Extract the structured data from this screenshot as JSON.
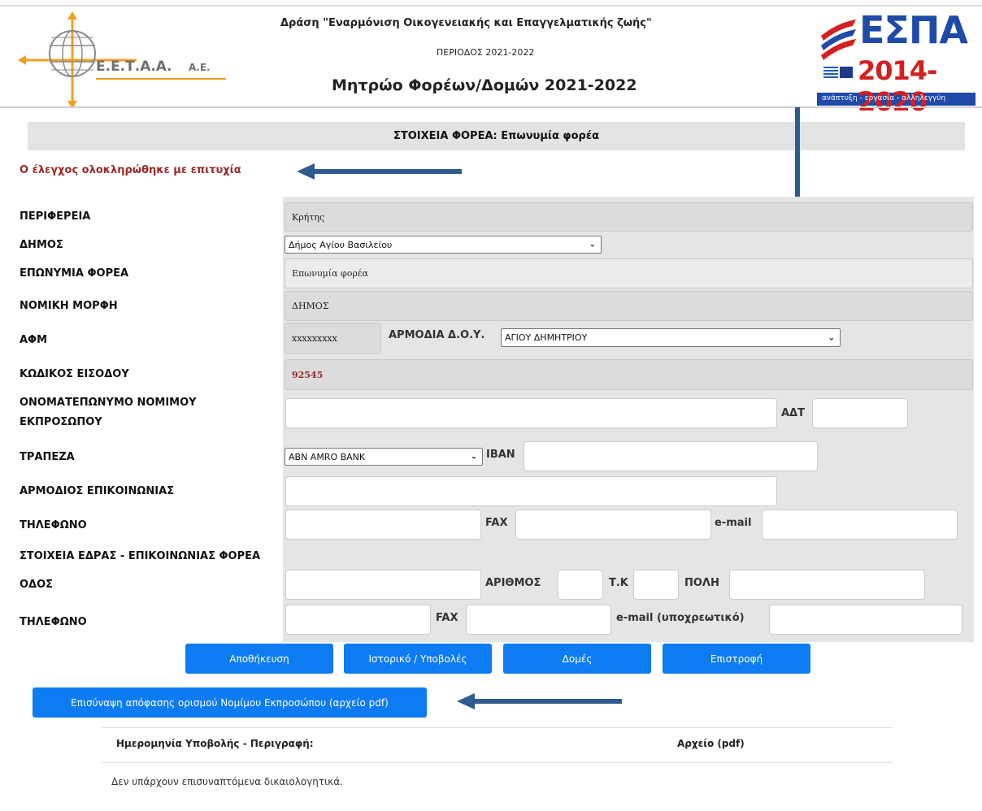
{
  "header": {
    "logo_text": "Ε.Ε.Τ.Α.Α.",
    "logo_suffix": "Α.Ε.",
    "action_title": "Δράση \"Εναρμόνιση Οικογενειακής και Επαγγελματικής ζωής\"",
    "period": "ΠΕΡΙΟΔΟΣ 2021-2022",
    "registry_title": "Μητρώο Φορέων/Δομών 2021-2022",
    "espa_logo": "ΕΣΠΑ",
    "espa_years": "2014-2020",
    "espa_slogan": "ανάπτυξη - εργασία - αλληλεγγύη"
  },
  "section_title": "ΣΤΟΙΧΕΙΑ ΦΟΡΕΑ: Επωνυμία φορέα",
  "success_message": "Ο έλεγχος ολοκληρώθηκε με επιτυχία",
  "labels": {
    "region": "ΠΕΡΙΦΕΡΕΙΑ",
    "municipality": "ΔΗΜΟΣ",
    "org_name": "ΕΠΩΝΥΜΙΑ ΦΟΡΕΑ",
    "legal_form": "ΝΟΜΙΚΗ ΜΟΡΦΗ",
    "afm": "ΑΦΜ",
    "tax_office": "ΑΡΜΟΔΙΑ Δ.Ο.Υ.",
    "login_code": "ΚΩΔΙΚΟΣ ΕΙΣΟΔΟΥ",
    "legal_rep_1": "ΟΝΟΜΑΤΕΠΩΝΥΜΟ ΝΟΜΙΜΟΥ",
    "legal_rep_2": "ΕΚΠΡΟΣΩΠΟΥ",
    "adt": "ΑΔΤ",
    "bank": "ΤΡΑΠΕΖΑ",
    "iban": "IBAN",
    "contact_person": "ΑΡΜΟΔΙΟΣ ΕΠΙΚΟΙΝΩΝΙΑΣ",
    "phone": "ΤΗΛΕΦΩΝΟ",
    "fax": "FAX",
    "email": "e-mail",
    "hq_header": "ΣΤΟΙΧΕΙΑ ΕΔΡΑΣ - ΕΠΙΚΟΙΝΩΝΙΑΣ ΦΟΡΕΑ",
    "street": "ΟΔΟΣ",
    "number": "ΑΡΙΘΜΟΣ",
    "postal_code": "Τ.Κ",
    "city": "ΠΟΛΗ",
    "phone2": "ΤΗΛΕΦΩΝΟ",
    "fax2": "FAX",
    "email_required": "e-mail (υποχρεωτικό)"
  },
  "values": {
    "region": "Κρήτης",
    "municipality": "Δήμος Αγίου Βασιλείου",
    "org_name": "Επωνυμία φορέα",
    "legal_form": "ΔΗΜΟΣ",
    "afm": "xxxxxxxxx",
    "tax_office": "ΑΓΙΟΥ ΔΗΜΗΤΡΙΟΥ",
    "login_code": "92545",
    "bank": "ABN AMRO BANK"
  },
  "buttons": {
    "save": "Αποθήκευση",
    "history": "Ιστορικό / Υποβολές",
    "structures": "Δομές",
    "back": "Επιστροφή",
    "attach": "Επισύναψη απόφασης ορισμού Νομίμου Εκπροσώπου (αρχείο pdf)"
  },
  "table": {
    "col_date": "Ημερομηνία Υποβολής - Περιγραφή:",
    "col_file": "Αρχείο (pdf)",
    "empty": "Δεν υπάρχουν επισυναπτόμενα δικαιολογητικά."
  },
  "colors": {
    "primary_button": "#0d7bf2",
    "success_text": "#9a2a2a",
    "arrow": "#2f5b8f"
  }
}
